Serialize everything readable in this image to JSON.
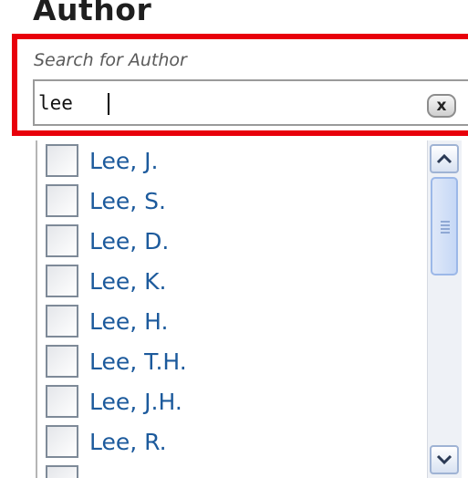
{
  "facet": {
    "title": "Author",
    "search": {
      "label": "Search for Author",
      "value": "lee",
      "clear_glyph": "x"
    },
    "items": [
      {
        "label": "Lee, J.",
        "checked": false
      },
      {
        "label": "Lee, S.",
        "checked": false
      },
      {
        "label": "Lee, D.",
        "checked": false
      },
      {
        "label": "Lee, K.",
        "checked": false
      },
      {
        "label": "Lee, H.",
        "checked": false
      },
      {
        "label": "Lee, T.H.",
        "checked": false
      },
      {
        "label": "Lee, J.H.",
        "checked": false
      },
      {
        "label": "Lee, R.",
        "checked": false
      }
    ]
  },
  "colors": {
    "highlight": "#e8000b",
    "link": "#1c5a9c"
  },
  "icons": {
    "clear": "close-icon",
    "scroll_up": "chevron-up-icon",
    "scroll_down": "chevron-down-icon"
  }
}
